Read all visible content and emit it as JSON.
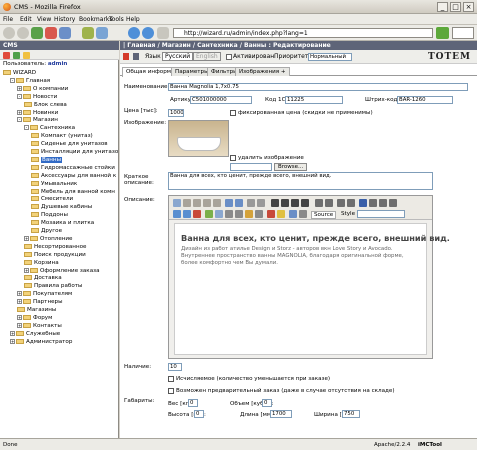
{
  "window": {
    "title": "CMS - Mozilla Firefox",
    "min": "_",
    "max": "□",
    "close": "×"
  },
  "menu": [
    "File",
    "Edit",
    "View",
    "History",
    "Bookmarks",
    "Tools",
    "Help"
  ],
  "nav": {
    "url": "http://wizard.ru/admin/index.php?lang=1"
  },
  "left": {
    "header": "CMS",
    "user_label": "Пользователь:",
    "user_name": "admin",
    "tree": [
      {
        "label": "WIZARD",
        "level": 0,
        "pm": ""
      },
      {
        "label": "Главная",
        "level": 1,
        "pm": "-"
      },
      {
        "label": "О компании",
        "level": 2,
        "pm": "+"
      },
      {
        "label": "Новости",
        "level": 2,
        "pm": "-"
      },
      {
        "label": "Блок слева",
        "level": 3,
        "pm": ""
      },
      {
        "label": "Новинки",
        "level": 2,
        "pm": "+"
      },
      {
        "label": "Магазин",
        "level": 2,
        "pm": "-"
      },
      {
        "label": "Сантехника",
        "level": 3,
        "pm": "-"
      },
      {
        "label": "Компакт (унитаз)",
        "level": 4,
        "pm": ""
      },
      {
        "label": "Сиденье для унитазов",
        "level": 4,
        "pm": ""
      },
      {
        "label": "Инсталляции для унитазо",
        "level": 4,
        "pm": ""
      },
      {
        "label": "Ванны",
        "level": 4,
        "pm": "",
        "selected": true
      },
      {
        "label": "Гидромассажные стойки",
        "level": 4,
        "pm": ""
      },
      {
        "label": "Аксессуары для ванной к",
        "level": 4,
        "pm": ""
      },
      {
        "label": "Умывальник",
        "level": 4,
        "pm": ""
      },
      {
        "label": "Мебель для ванной комн",
        "level": 4,
        "pm": ""
      },
      {
        "label": "Смесители",
        "level": 4,
        "pm": ""
      },
      {
        "label": "Душевые кабины",
        "level": 4,
        "pm": ""
      },
      {
        "label": "Поддоны",
        "level": 4,
        "pm": ""
      },
      {
        "label": "Мозаика и плитка",
        "level": 4,
        "pm": ""
      },
      {
        "label": "Другое",
        "level": 4,
        "pm": ""
      },
      {
        "label": "Отопление",
        "level": 3,
        "pm": "+"
      },
      {
        "label": "Несортированное",
        "level": 3,
        "pm": ""
      },
      {
        "label": "Поиск продукции",
        "level": 3,
        "pm": ""
      },
      {
        "label": "Корзина",
        "level": 3,
        "pm": ""
      },
      {
        "label": "Оформление заказа",
        "level": 3,
        "pm": "+"
      },
      {
        "label": "Доставка",
        "level": 3,
        "pm": ""
      },
      {
        "label": "Правила работы",
        "level": 3,
        "pm": ""
      },
      {
        "label": "Покупателям",
        "level": 2,
        "pm": "+"
      },
      {
        "label": "Партнеры",
        "level": 2,
        "pm": "+"
      },
      {
        "label": "Магазины",
        "level": 2,
        "pm": ""
      },
      {
        "label": "Форум",
        "level": 2,
        "pm": "+"
      },
      {
        "label": "Контакты",
        "level": 2,
        "pm": "+"
      },
      {
        "label": "Служебные",
        "level": 1,
        "pm": "+"
      },
      {
        "label": "Администратор",
        "level": 1,
        "pm": "+"
      }
    ]
  },
  "right": {
    "header": "| Главная / Магазин / Сантехника / Ванны : Редактирование",
    "toolbar": {
      "lang_ru": "Русский",
      "lang_en": "English",
      "lang_label": "Язык",
      "active": "Активирован",
      "producer_label": "Приоритет",
      "producer_value": "Нормальный"
    },
    "logo": "TOTEM",
    "tabs": [
      "Общая информация",
      "Параметры",
      "Фильтры",
      "Изображения +"
    ],
    "form": {
      "name_label": "Наименование:",
      "name_value": "Ванна Magnolia 1,7x0.75",
      "article_label": "Артикул:",
      "article_value": "С501000000",
      "code1c_label": "Код 1С:",
      "code1c_value": "11225",
      "barcode_label": "Штрих-код:",
      "barcode_value": "BAR-1260",
      "price_label": "Цена [тыс]:",
      "price_value": "1000",
      "fixed_price_label": "фиксированная цена (скидки не применимы)",
      "image_label": "Изображение:",
      "delete_image_label": "удалить изображение",
      "browse_label": "Browse...",
      "short_label": "Краткое описание:",
      "short_value": "Ванна для всех, кто ценит, прежде всего, внешний вид.",
      "desc_label": "Описание:",
      "editor_source": "Source",
      "editor_style": "Style",
      "editor_heading": "Ванна для всех, кто ценит, прежде всего, внешний вид.",
      "editor_text": "Дизайн из работ атилье Design и Storz - авторов вкн Love Story и Avocado. Внутреннее пространство ванны MAGNOLIA, благодаря оригинальной форме, более комфортно чем Вы думали.",
      "stock_label": "Наличие:",
      "stock_value": "10",
      "stock_cb1": "Исчисляемое (количество уменьшается при заказе)",
      "stock_cb2": "Возможен предварительный заказ (даже в случае отсутствия на складе)",
      "dims_label": "Габариты:",
      "weight_label": "Вес [кг]:",
      "weight_value": "0",
      "volume_label": "Объем [куб.м]:",
      "volume_value": "0",
      "height_label": "Высота [мм]:",
      "height_value": "0",
      "length_label": "Длина [мм]:",
      "length_value": "1700",
      "width_label": "Ширина [мм]:",
      "width_value": "750"
    }
  },
  "status": {
    "left": "Done",
    "right": "Apache/2.2.4",
    "tool": "iMCTool"
  }
}
